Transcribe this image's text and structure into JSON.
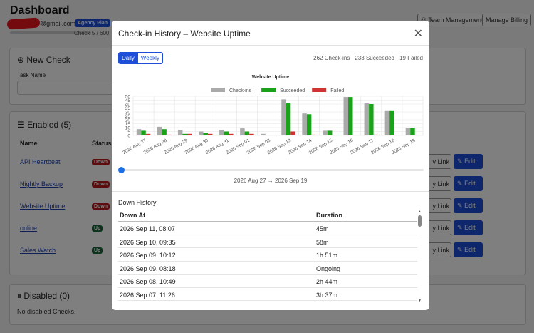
{
  "dashboard": {
    "title": "Dashboard",
    "email_suffix": "@gmail.com",
    "plan": "Agency Plan",
    "check_count": "Check 5 / 600",
    "team_button": "⚇ Team Management",
    "billing_button": "Manage Billing",
    "new_check": {
      "title": "New Check",
      "task_label": "Task Name"
    },
    "enabled": {
      "title": "Enabled (5)",
      "col_name": "Name",
      "col_status": "Status",
      "rows": [
        {
          "name": "API Heartbeat",
          "status": "Down"
        },
        {
          "name": "Nightly Backup",
          "status": "Down"
        },
        {
          "name": "Website Uptime",
          "status": "Down"
        },
        {
          "name": "online",
          "status": "Up"
        },
        {
          "name": "Sales Watch",
          "status": "Up"
        }
      ],
      "copy_label": "y Link",
      "edit_label": "Edit"
    },
    "disabled": {
      "title": "Disabled (0)",
      "empty": "No disabled Checks."
    }
  },
  "modal": {
    "title": "Check-in History – Website Uptime",
    "close": "✕",
    "tab_daily": "Daily",
    "tab_weekly": "Weekly",
    "summary": "262 Check-ins · 233 Succeeded · 19 Failed",
    "range_caption": "2026 Aug 27 → 2026 Sep 19",
    "down_history": {
      "title": "Down History",
      "col_down_at": "Down At",
      "col_duration": "Duration",
      "rows": [
        {
          "down_at": "2026 Sep 11, 08:07",
          "duration": "45m"
        },
        {
          "down_at": "2026 Sep 10, 09:35",
          "duration": "58m"
        },
        {
          "down_at": "2026 Sep 09, 10:12",
          "duration": "1h 51m"
        },
        {
          "down_at": "2026 Sep 09, 08:18",
          "duration": "Ongoing"
        },
        {
          "down_at": "2026 Sep 08, 10:49",
          "duration": "2h 44m"
        },
        {
          "down_at": "2026 Sep 07, 11:26",
          "duration": "3h 37m"
        }
      ]
    }
  },
  "colors": {
    "checkins": "#aaaaaa",
    "succeeded": "#1aa31a",
    "failed": "#d13232",
    "accent": "#1d4fd8"
  },
  "chart_data": {
    "type": "bar",
    "title": "Website Uptime",
    "categories": [
      "2026 Aug 27",
      "2026 Aug 28",
      "2026 Aug 29",
      "2026 Aug 30",
      "2026 Aug 31",
      "2026 Sep 01",
      "2026 Sep 08",
      "2026 Sep 13",
      "2026 Sep 14",
      "2026 Sep 15",
      "2026 Sep 16",
      "2026 Sep 17",
      "2026 Sep 18",
      "2026 Sep 19"
    ],
    "series": [
      {
        "name": "Check-ins",
        "values": [
          8,
          11,
          7,
          5,
          7,
          9,
          2,
          46,
          28,
          6,
          49,
          41,
          32,
          10
        ]
      },
      {
        "name": "Succeeded",
        "values": [
          6,
          8,
          2,
          3,
          5,
          5,
          0,
          41,
          27,
          6,
          49,
          40,
          32,
          10
        ]
      },
      {
        "name": "Failed",
        "values": [
          2,
          1,
          2,
          2,
          2,
          2,
          0,
          5,
          1,
          0,
          0,
          1,
          0,
          0
        ]
      }
    ],
    "ylim": [
      0,
      50
    ],
    "yticks": [
      0,
      5,
      10,
      15,
      20,
      25,
      30,
      35,
      40,
      45,
      50
    ],
    "grid": true,
    "legend": "top-center"
  }
}
